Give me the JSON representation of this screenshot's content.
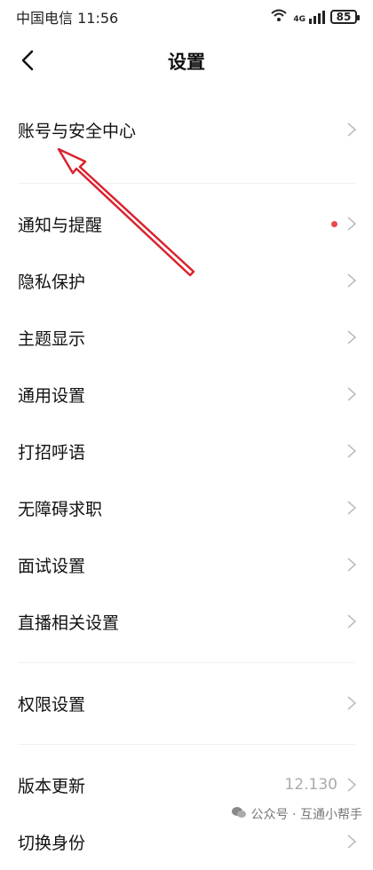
{
  "status_bar": {
    "carrier_time": "中国电信 11:56",
    "signal_label": "4G",
    "battery": "85"
  },
  "nav": {
    "title": "设置",
    "back_icon": "chevron-left-icon"
  },
  "items": [
    {
      "label": "账号与安全中心"
    },
    {
      "label": "通知与提醒"
    },
    {
      "label": "隐私保护"
    },
    {
      "label": "主题显示"
    },
    {
      "label": "通用设置"
    },
    {
      "label": "打招呼语"
    },
    {
      "label": "无障碍求职"
    },
    {
      "label": "面试设置"
    },
    {
      "label": "直播相关设置"
    },
    {
      "label": "权限设置"
    },
    {
      "label": "版本更新",
      "value": "12.130"
    },
    {
      "label": "切换身份"
    }
  ],
  "colors": {
    "annotation_arrow": "#d9232e",
    "badge_dot": "#e94850"
  },
  "watermark": "公众号 · 互通小帮手"
}
